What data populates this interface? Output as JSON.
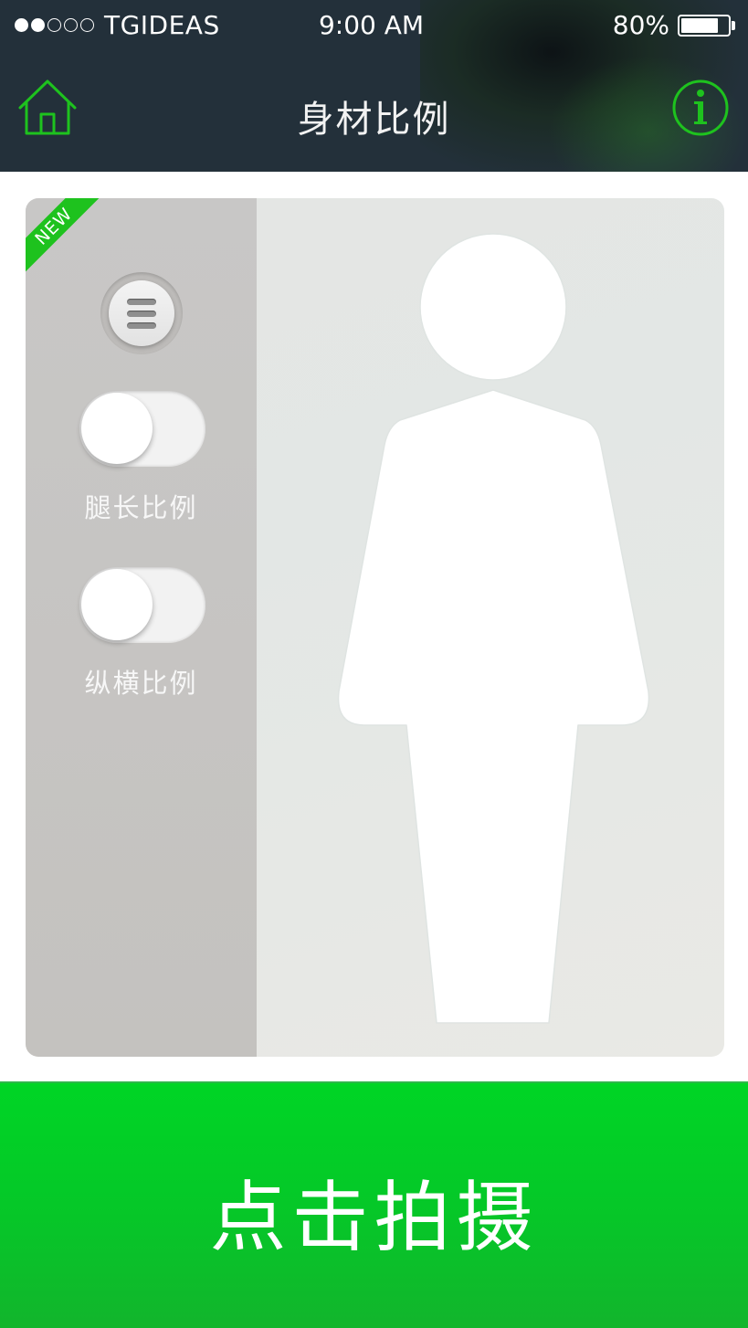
{
  "status_bar": {
    "carrier": "TGIDEAS",
    "time": "9:00 AM",
    "battery": "80%",
    "battery_level": 0.8,
    "signal_bars": 2,
    "signal_total": 5
  },
  "nav": {
    "title": "身材比例",
    "left_icon": "home-icon",
    "right_icon": "info-icon"
  },
  "card": {
    "badge": "NEW",
    "menu_icon": "menu-icon",
    "toggles": [
      {
        "label": "腿长比例",
        "on": false
      },
      {
        "label": "纵横比例",
        "on": false
      }
    ],
    "figure_icon": "person-silhouette-icon"
  },
  "capture_button": {
    "label": "点击拍摄"
  },
  "colors": {
    "accent": "#1ec21e",
    "header_bg": "#23303a",
    "capture_bg": "#05c828"
  }
}
